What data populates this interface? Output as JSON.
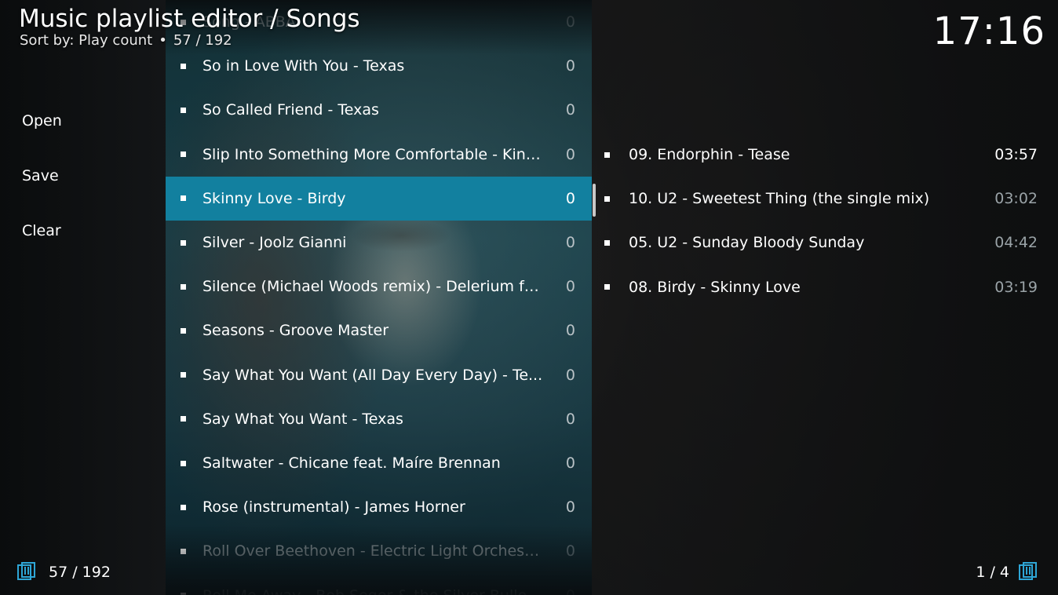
{
  "header": {
    "title": "Music playlist editor / Songs",
    "sort_label": "Sort by: Play count",
    "separator": "•",
    "position": "57 / 192"
  },
  "clock": "17:16",
  "menu": {
    "items": [
      {
        "label": "Open"
      },
      {
        "label": "Save"
      },
      {
        "label": "Clear"
      }
    ]
  },
  "songs": [
    {
      "title": "Song - ABBA",
      "count": "0"
    },
    {
      "title": "So in Love With You - Texas",
      "count": "0"
    },
    {
      "title": "So Called Friend - Texas",
      "count": "0"
    },
    {
      "title": "Slip Into Something More Comfortable - Kinobe",
      "count": "0"
    },
    {
      "title": "Skinny Love - Birdy",
      "count": "0"
    },
    {
      "title": "Silver - Joolz Gianni",
      "count": "0"
    },
    {
      "title": "Silence (Michael Woods remix) - Delerium fe...",
      "count": "0"
    },
    {
      "title": "Seasons - Groove Master",
      "count": "0"
    },
    {
      "title": "Say What You Want (All Day Every Day) - Te...",
      "count": "0"
    },
    {
      "title": "Say What You Want - Texas",
      "count": "0"
    },
    {
      "title": "Saltwater - Chicane feat. Maíre Brennan",
      "count": "0"
    },
    {
      "title": "Rose (instrumental) - James Horner",
      "count": "0"
    },
    {
      "title": "Roll Over Beethoven - Electric Light Orchestra",
      "count": "0"
    },
    {
      "title": "Roll Me Away - Bob Seger & the Silver Bullet...",
      "count": "0"
    }
  ],
  "selected_song_index": 4,
  "playlist": [
    {
      "title": "09. Endorphin - Tease",
      "duration": "03:57"
    },
    {
      "title": "10. U2 - Sweetest Thing (the single mix)",
      "duration": "03:02"
    },
    {
      "title": "05. U2 - Sunday Bloody Sunday",
      "duration": "04:42"
    },
    {
      "title": "08. Birdy - Skinny Love",
      "duration": "03:19"
    }
  ],
  "footer": {
    "left_count": "57 / 192",
    "right_page": "1 / 4"
  },
  "colors": {
    "selection": "#12809f",
    "accent_icon": "#2ea6d6"
  },
  "icons": {
    "footer_left": "list-pages-icon",
    "footer_right": "list-pages-icon"
  }
}
